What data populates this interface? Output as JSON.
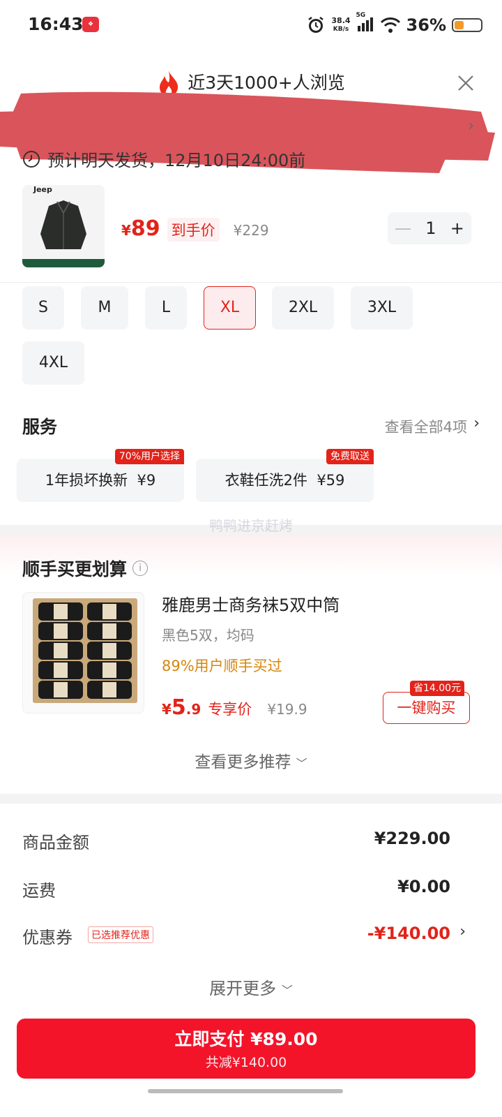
{
  "status_bar": {
    "time": "16:43",
    "net_speed_value": "38.4",
    "net_speed_unit": "KB/s",
    "network": "5G",
    "battery_pct": "36%",
    "battery_level": 0.36
  },
  "popup": {
    "views_text": "近3天1000+人浏览",
    "shipping_text": "预计明天发货，12月10日24:00前"
  },
  "product": {
    "thumb_brand": "Jeep",
    "currency": "¥",
    "price_now": "89",
    "price_label": "到手价",
    "price_original": "¥229",
    "quantity": "1"
  },
  "sizes": [
    "S",
    "M",
    "L",
    "XL",
    "2XL",
    "3XL",
    "4XL"
  ],
  "selected_size": "XL",
  "services": {
    "title": "服务",
    "view_all": "查看全部4项",
    "items": [
      {
        "label": "1年损坏换新",
        "price": "¥9",
        "badge": "70%用户选择"
      },
      {
        "label": "衣鞋任洗2件",
        "price": "¥59",
        "badge": "免费取送"
      }
    ]
  },
  "watermark": "鸭鸭进京赶烤",
  "addon": {
    "title": "顺手买更划算",
    "name": "雅鹿男士商务袜5双中筒",
    "spec": "黑色5双，均码",
    "hot_text": "89%用户顺手买过",
    "currency": "¥",
    "price_int": "5",
    "price_dec": ".9",
    "price_label": "专享价",
    "price_original": "¥19.9",
    "save_badge": "省14.00元",
    "buy_label": "一键购买",
    "more_label": "查看更多推荐"
  },
  "summary": {
    "goods_label": "商品金额",
    "goods_value": "¥229.00",
    "freight_label": "运费",
    "freight_value": "¥0.00",
    "coupon_label": "优惠券",
    "coupon_tag": "已选推荐优惠",
    "coupon_value": "-¥140.00",
    "expand_label": "展开更多"
  },
  "pay": {
    "main_label": "立即支付 ¥89.00",
    "sub_label": "共减¥140.00"
  },
  "colors": {
    "accent": "#e2231a",
    "pay_button": "#f3142a",
    "hot_orange": "#d6860e"
  }
}
